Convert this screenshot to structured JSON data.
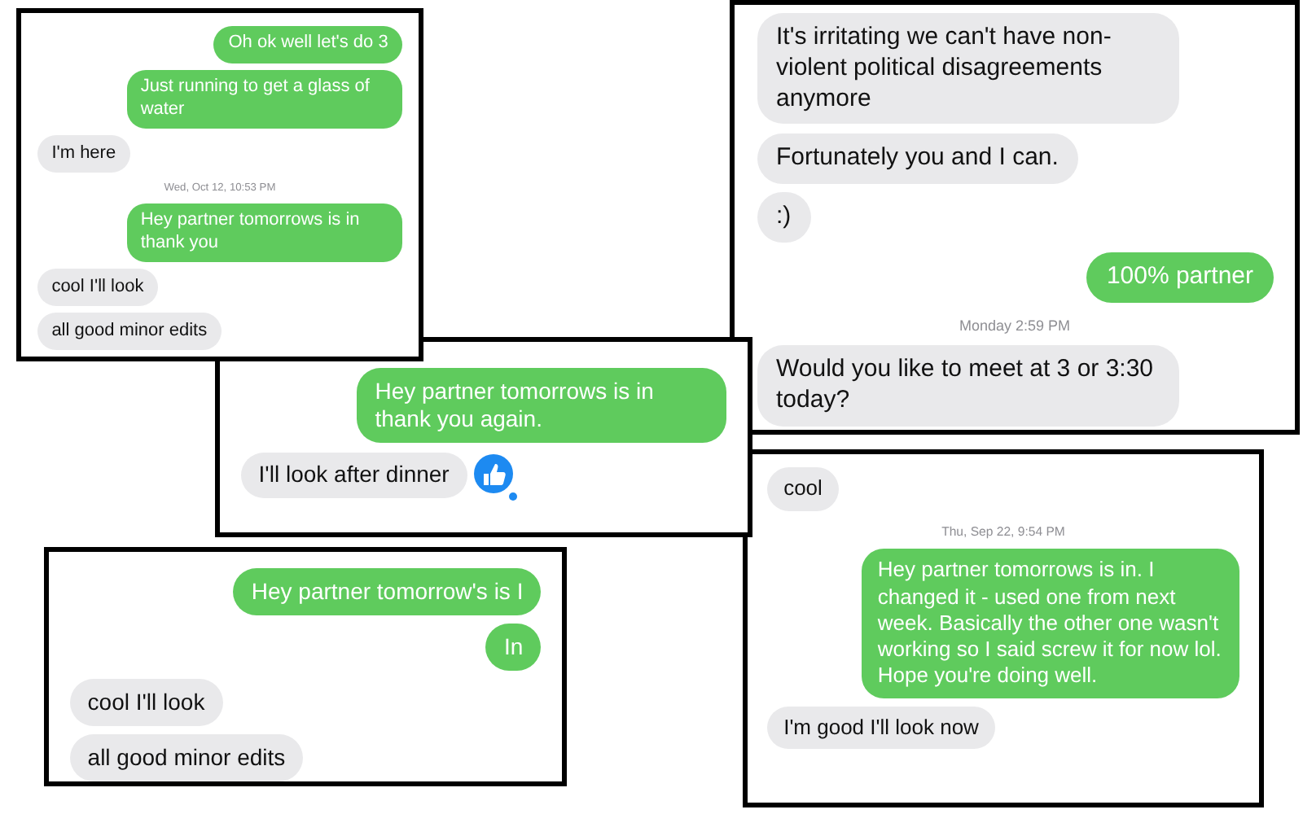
{
  "screenshots": [
    {
      "messages": [
        {
          "kind": "sent",
          "text": "Oh ok well let's do 3"
        },
        {
          "kind": "sent",
          "text": "Just running to get a glass of water"
        },
        {
          "kind": "received",
          "text": "I'm here"
        },
        {
          "kind": "timestamp",
          "text": "Wed, Oct 12, 10:53 PM"
        },
        {
          "kind": "sent",
          "text": "Hey partner tomorrows is in thank you"
        },
        {
          "kind": "received",
          "text": "cool I'll look"
        },
        {
          "kind": "received",
          "text": "all good minor edits"
        }
      ]
    },
    {
      "messages": [
        {
          "kind": "sent",
          "text": "Hey partner tomorrows is in thank you again."
        },
        {
          "kind": "received",
          "text": "I'll look after dinner",
          "liked": true
        }
      ]
    },
    {
      "messages": [
        {
          "kind": "received",
          "text": "It's irritating we can't have non-violent political disagreements anymore"
        },
        {
          "kind": "received",
          "text": "Fortunately you and I can."
        },
        {
          "kind": "received",
          "text": ":)"
        },
        {
          "kind": "sent",
          "text": "100% partner"
        },
        {
          "kind": "timestamp",
          "text": "Monday 2:59 PM"
        },
        {
          "kind": "received",
          "text": "Would you like to meet at 3 or 3:30 today?"
        }
      ]
    },
    {
      "messages": [
        {
          "kind": "sent",
          "text": "Hey partner tomorrow's is I"
        },
        {
          "kind": "sent",
          "text": "In"
        },
        {
          "kind": "received",
          "text": "cool I'll look"
        },
        {
          "kind": "received",
          "text": "all good minor edits"
        }
      ]
    },
    {
      "messages": [
        {
          "kind": "received",
          "text": "cool"
        },
        {
          "kind": "timestamp",
          "text": "Thu, Sep 22, 9:54 PM"
        },
        {
          "kind": "sent",
          "text": "Hey partner tomorrows is in. I changed it - used one from next week. Basically the other one wasn't working so I said screw it for now lol. Hope you're doing well."
        },
        {
          "kind": "received",
          "text": "I'm good I'll look now"
        }
      ]
    }
  ]
}
